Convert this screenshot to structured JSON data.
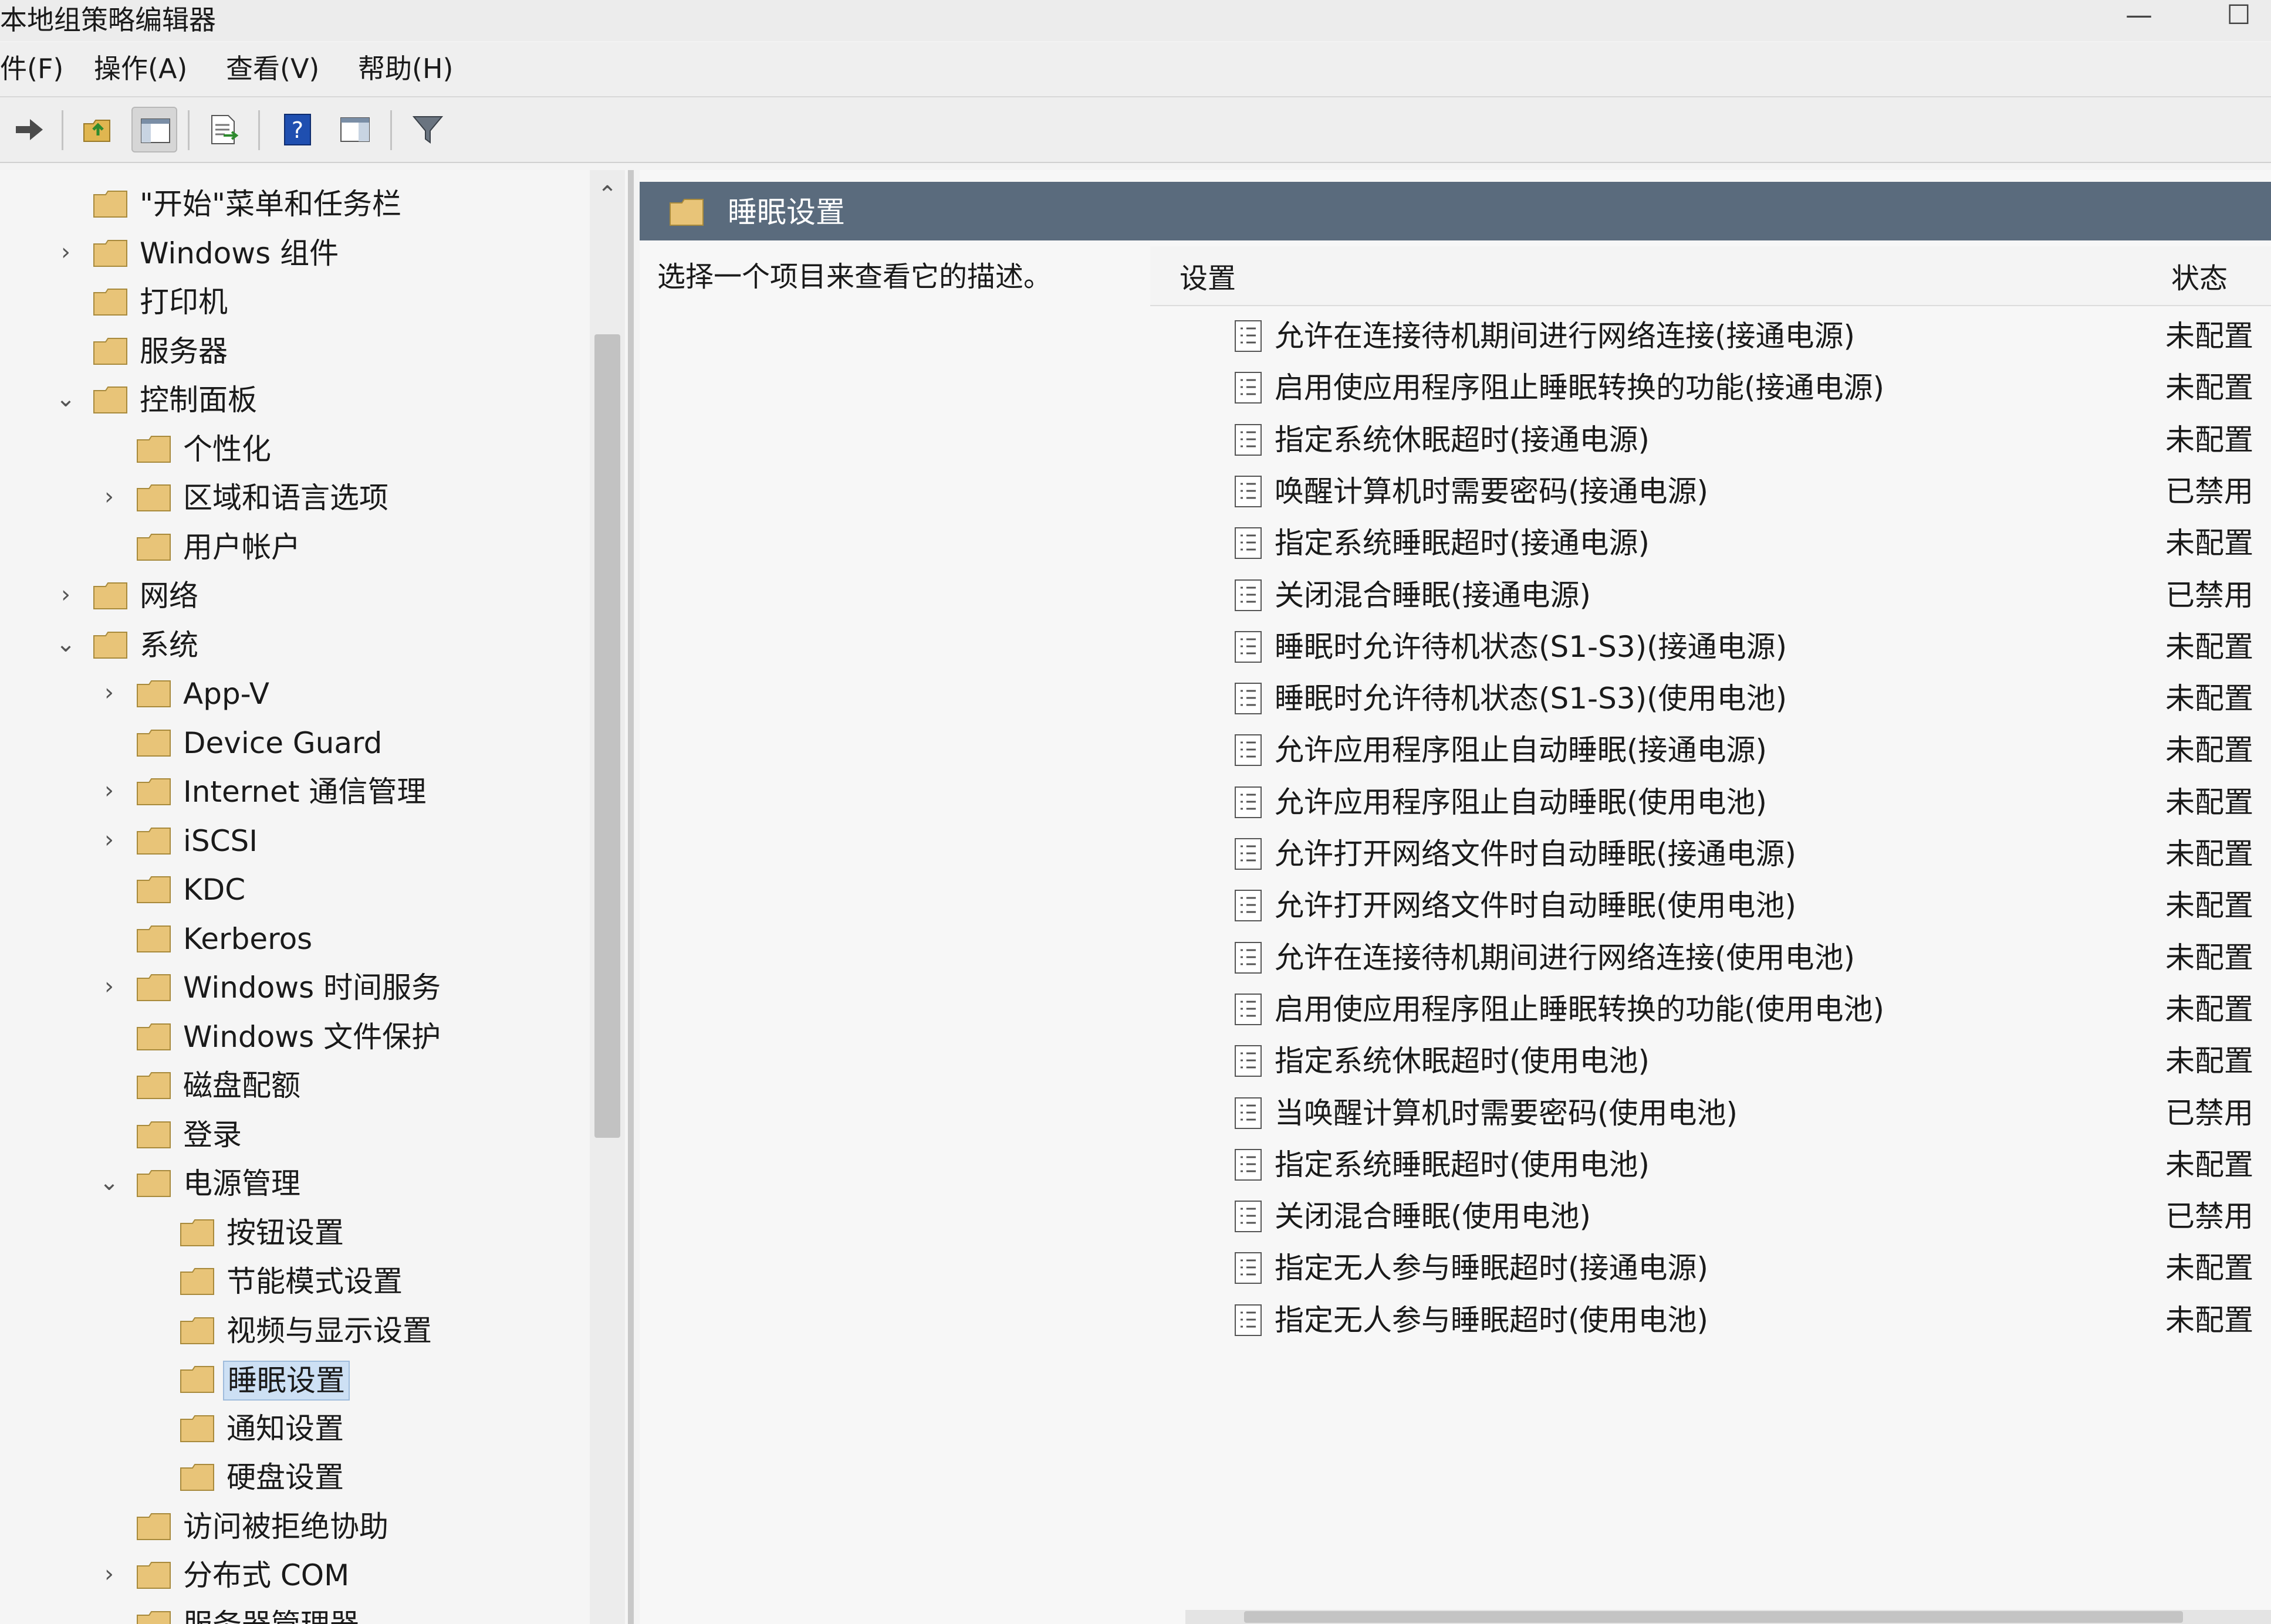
{
  "window": {
    "title": "本地组策略编辑器",
    "minimize_glyph": "—",
    "maximize_glyph": "☐"
  },
  "menu": {
    "file": "件(F)",
    "action": "操作(A)",
    "view": "查看(V)",
    "help": "帮助(H)"
  },
  "toolbar": {
    "buttons": [
      "forward-icon",
      "up-folder-icon",
      "show-hide-tree-icon",
      "export-list-icon",
      "help-icon",
      "properties-view-icon",
      "filter-icon"
    ]
  },
  "tree": {
    "scroll_up_glyph": "⌃",
    "items": [
      {
        "label": "\"开始\"菜单和任务栏",
        "expander": ""
      },
      {
        "label": "Windows 组件",
        "expander": "›"
      },
      {
        "label": "打印机",
        "expander": ""
      },
      {
        "label": "服务器",
        "expander": ""
      },
      {
        "label": "控制面板",
        "expander": "⌄"
      },
      {
        "label": "个性化",
        "expander": ""
      },
      {
        "label": "区域和语言选项",
        "expander": "›"
      },
      {
        "label": "用户帐户",
        "expander": ""
      },
      {
        "label": "网络",
        "expander": "›"
      },
      {
        "label": "系统",
        "expander": "⌄"
      },
      {
        "label": "App-V",
        "expander": "›"
      },
      {
        "label": "Device Guard",
        "expander": ""
      },
      {
        "label": "Internet 通信管理",
        "expander": "›"
      },
      {
        "label": "iSCSI",
        "expander": "›"
      },
      {
        "label": "KDC",
        "expander": ""
      },
      {
        "label": "Kerberos",
        "expander": ""
      },
      {
        "label": "Windows 时间服务",
        "expander": "›"
      },
      {
        "label": "Windows 文件保护",
        "expander": ""
      },
      {
        "label": "磁盘配额",
        "expander": ""
      },
      {
        "label": "登录",
        "expander": ""
      },
      {
        "label": "电源管理",
        "expander": "⌄"
      },
      {
        "label": "按钮设置",
        "expander": ""
      },
      {
        "label": "节能模式设置",
        "expander": ""
      },
      {
        "label": "视频与显示设置",
        "expander": ""
      },
      {
        "label": "睡眠设置",
        "expander": ""
      },
      {
        "label": "通知设置",
        "expander": ""
      },
      {
        "label": "硬盘设置",
        "expander": ""
      },
      {
        "label": "访问被拒绝协助",
        "expander": ""
      },
      {
        "label": "分布式 COM",
        "expander": "›"
      },
      {
        "label": "服务器管理器",
        "expander": ""
      }
    ]
  },
  "right": {
    "header_title": "睡眠设置",
    "description": "选择一个项目来查看它的描述。",
    "col_setting": "设置",
    "col_status": "状态",
    "policies": [
      {
        "name": "允许在连接待机期间进行网络连接(接通电源)",
        "status": "未配置"
      },
      {
        "name": "启用使应用程序阻止睡眠转换的功能(接通电源)",
        "status": "未配置"
      },
      {
        "name": "指定系统休眠超时(接通电源)",
        "status": "未配置"
      },
      {
        "name": "唤醒计算机时需要密码(接通电源)",
        "status": "已禁用"
      },
      {
        "name": "指定系统睡眠超时(接通电源)",
        "status": "未配置"
      },
      {
        "name": "关闭混合睡眠(接通电源)",
        "status": "已禁用"
      },
      {
        "name": "睡眠时允许待机状态(S1-S3)(接通电源)",
        "status": "未配置"
      },
      {
        "name": "睡眠时允许待机状态(S1-S3)(使用电池)",
        "status": "未配置"
      },
      {
        "name": "允许应用程序阻止自动睡眠(接通电源)",
        "status": "未配置"
      },
      {
        "name": "允许应用程序阻止自动睡眠(使用电池)",
        "status": "未配置"
      },
      {
        "name": "允许打开网络文件时自动睡眠(接通电源)",
        "status": "未配置"
      },
      {
        "name": "允许打开网络文件时自动睡眠(使用电池)",
        "status": "未配置"
      },
      {
        "name": "允许在连接待机期间进行网络连接(使用电池)",
        "status": "未配置"
      },
      {
        "name": "启用使应用程序阻止睡眠转换的功能(使用电池)",
        "status": "未配置"
      },
      {
        "name": "指定系统休眠超时(使用电池)",
        "status": "未配置"
      },
      {
        "name": "当唤醒计算机时需要密码(使用电池)",
        "status": "已禁用"
      },
      {
        "name": "指定系统睡眠超时(使用电池)",
        "status": "未配置"
      },
      {
        "name": "关闭混合睡眠(使用电池)",
        "status": "已禁用"
      },
      {
        "name": "指定无人参与睡眠超时(接通电源)",
        "status": "未配置"
      },
      {
        "name": "指定无人参与睡眠超时(使用电池)",
        "status": "未配置"
      }
    ]
  },
  "colors": {
    "header_bg": "#5a6b7d",
    "folder": "#e8c478",
    "selection": "#cde0f4"
  }
}
